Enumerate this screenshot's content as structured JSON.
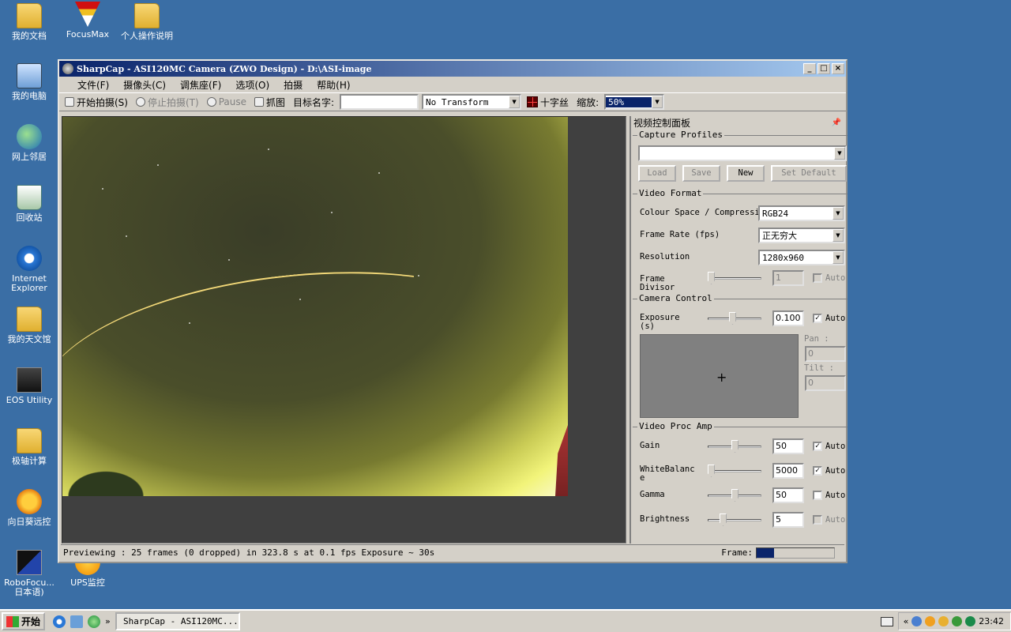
{
  "desktop": {
    "icons": [
      {
        "label": "我的文档"
      },
      {
        "label": "FocusMax"
      },
      {
        "label": "个人操作说明"
      },
      {
        "label": "我的电脑"
      },
      {
        "label": "网上邻居"
      },
      {
        "label": "回收站"
      },
      {
        "label": "Internet Explorer"
      },
      {
        "label": "我的天文馆"
      },
      {
        "label": "EOS Utility"
      },
      {
        "label": "极轴计算"
      },
      {
        "label": "向日葵远控"
      },
      {
        "label": "RoboFocu... 日本语)"
      },
      {
        "label": "UPS监控"
      }
    ]
  },
  "window": {
    "title": "SharpCap - ASI120MC Camera (ZWO Design) - D:\\ASI-image",
    "controls": {
      "minimize": "_",
      "maximize": "□",
      "close": "×"
    }
  },
  "menu": [
    "文件(F)",
    "摄像头(C)",
    "调焦座(F)",
    "选项(O)",
    "拍摄",
    "帮助(H)"
  ],
  "toolbar": {
    "start_capture": "开始拍摄(S)",
    "stop_capture": "停止拍摄(T)",
    "pause": "Pause",
    "snapshot": "抓图",
    "target_name_label": "目标名字:",
    "target_name_value": "",
    "transform": "No Transform",
    "crosshair": "十字丝",
    "zoom_label": "缩放:",
    "zoom_value": "50%"
  },
  "panel": {
    "title": "视频控制面板",
    "pin": "📌",
    "capture_profiles": {
      "title": "Capture Profiles",
      "selected": "",
      "buttons": {
        "load": "Load",
        "save": "Save",
        "new": "New",
        "set_default": "Set Default"
      }
    },
    "video_format": {
      "title": "Video Format",
      "colour_space_label": "Colour Space / Compressio",
      "colour_space_value": "RGB24",
      "frame_rate_label": "Frame Rate (fps)",
      "frame_rate_value": "正无穷大",
      "resolution_label": "Resolution",
      "resolution_value": "1280x960",
      "frame_divisor_label": "Frame Divisor",
      "frame_divisor_value": "1",
      "frame_divisor_auto": "Auto"
    },
    "camera_control": {
      "title": "Camera Control",
      "exposure_label": "Exposure (s)",
      "exposure_value": "0.100",
      "exposure_auto": "Auto",
      "pan_label": "Pan :",
      "pan_value": "0",
      "tilt_label": "Tilt :",
      "tilt_value": "0"
    },
    "video_proc_amp": {
      "title": "Video Proc Amp",
      "gain_label": "Gain",
      "gain_value": "50",
      "whitebalance_label": "WhiteBalance",
      "whitebalance_value": "5000",
      "gamma_label": "Gamma",
      "gamma_value": "50",
      "brightness_label": "Brightness",
      "brightness_value": "5",
      "auto": "Auto"
    }
  },
  "status": {
    "text": "Previewing : 25 frames (0 dropped) in 323.8 s at 0.1 fps Exposure ~ 30s",
    "frame_label": "Frame:",
    "frame_progress": 0.22
  },
  "taskbar": {
    "start": "开始",
    "task": "SharpCap - ASI120MC...",
    "more": "»",
    "tray_arrow": "«",
    "time": "23:42"
  }
}
